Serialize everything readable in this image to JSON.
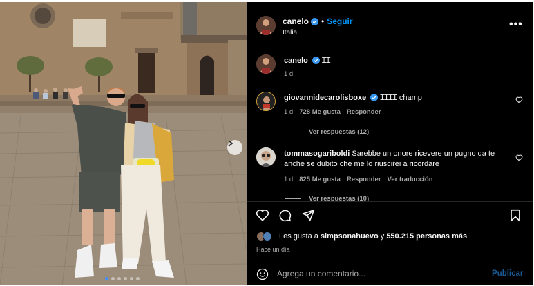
{
  "post": {
    "author": "canelo",
    "follow_label": "Seguir",
    "separator": "•",
    "location": "Italia",
    "more_label": "•••"
  },
  "caption": {
    "author": "canelo",
    "text": "ꞮꞮ",
    "time": "1 d"
  },
  "comments": [
    {
      "author": "giovannidecarolisboxe",
      "text": "ꞮꞮꞮꞮ champ",
      "time": "1 d",
      "likes": "728 Me gusta",
      "reply": "Responder",
      "view_replies": "Ver respuestas (12)"
    },
    {
      "author": "tommasogariboldi",
      "text": "Sarebbe un onore ricevere un pugno da te anche se dubito che me lo riuscirei a ricordare",
      "time": "1 d",
      "likes": "825 Me gusta",
      "reply": "Responder",
      "translate": "Ver traducción",
      "view_replies": "Ver respuestas (10)"
    }
  ],
  "likes_line": {
    "prefix": "Les gusta a",
    "user": "simpsonahuevo",
    "conj": "y",
    "count": "550.215 personas más"
  },
  "posted_ago": "Hace un día",
  "comment_box": {
    "placeholder": "Agrega un comentario...",
    "publish_label": "Publicar"
  },
  "carousel": {
    "total": 6,
    "active": 1
  },
  "colors": {
    "accent": "#0095f6",
    "verified": "#3897f0",
    "background": "#000000",
    "muted": "#a8a8a8"
  },
  "icons": [
    "heart-icon",
    "comment-icon",
    "share-icon",
    "bookmark-icon",
    "smile-icon",
    "chevron-right-icon",
    "verified-icon"
  ]
}
